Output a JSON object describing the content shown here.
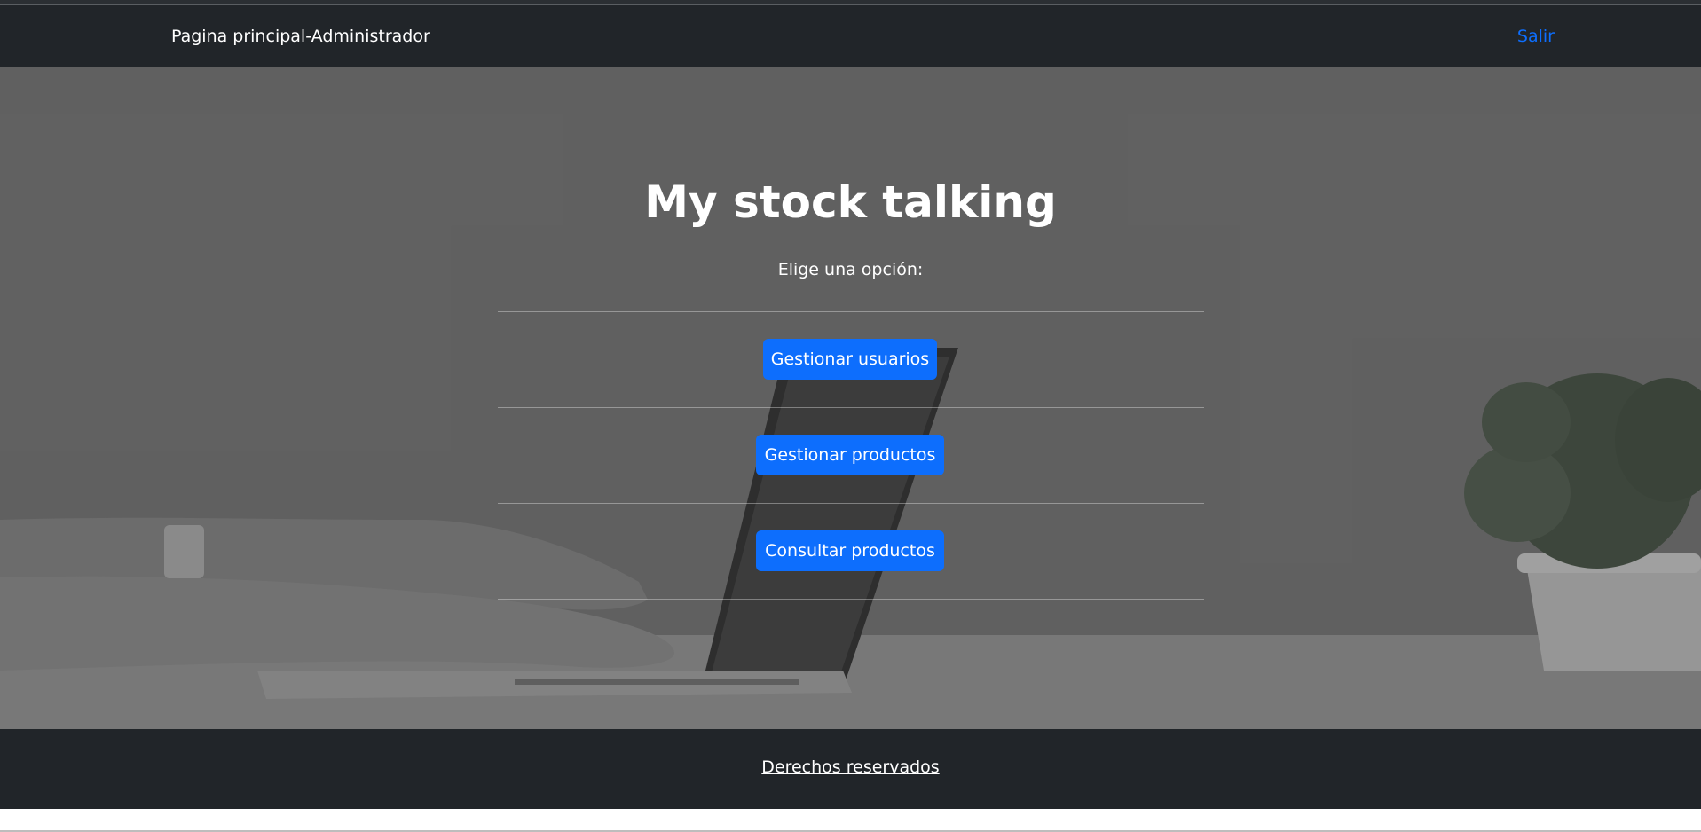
{
  "navbar": {
    "brand": "Pagina principal-Administrador",
    "logout_label": "Salir"
  },
  "hero": {
    "title": "My stock talking",
    "subtitle": "Elige una opción:",
    "buttons": [
      {
        "label": "Gestionar usuarios"
      },
      {
        "label": "Gestionar productos"
      },
      {
        "label": "Consultar productos"
      }
    ]
  },
  "footer": {
    "label": "Derechos reservados"
  },
  "colors": {
    "navbar_bg": "#212529",
    "primary": "#0d6efd",
    "link": "#0d6efd",
    "hero_overlay": "#6e6e6e"
  }
}
